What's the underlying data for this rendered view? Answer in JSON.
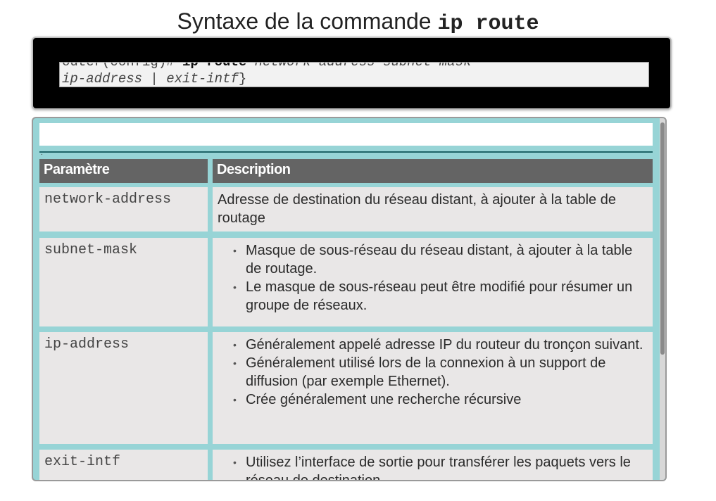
{
  "title": {
    "text": "Syntaxe de la commande ",
    "command": "ip route"
  },
  "command_box": {
    "line1_prompt": "outer(config)# ",
    "line1_keyword": "ip route",
    "line1_args": " network-address subnet-mask",
    "line2_args1": "ip-address",
    "line2_sep": " | ",
    "line2_args2": "exit-intf",
    "line2_end": "}"
  },
  "table": {
    "headers": {
      "param": "Paramètre",
      "desc": "Description"
    },
    "rows": [
      {
        "param": "network-address",
        "text": "Adresse de destination du réseau distant, à ajouter à la table de routage"
      },
      {
        "param": "subnet-mask",
        "bullets": [
          "Masque de sous-réseau du réseau distant, à ajouter à la table de routage.",
          "Le masque de sous-réseau peut être modifié pour résumer un groupe de réseaux."
        ]
      },
      {
        "param": "ip-address",
        "bullets": [
          "Généralement appelé adresse IP du routeur du tronçon suivant.",
          "Généralement utilisé lors de la connexion à un support de diffusion (par exemple Ethernet).",
          "Crée généralement une recherche récursive"
        ]
      },
      {
        "param": "exit-intf",
        "bullets": [
          "Utilisez l’interface de sortie pour transférer les paquets vers le réseau de destination."
        ]
      }
    ]
  },
  "colors": {
    "panel_bg": "#97d4d6",
    "header_bg": "#646464",
    "cell_bg": "#e9e7e7"
  }
}
